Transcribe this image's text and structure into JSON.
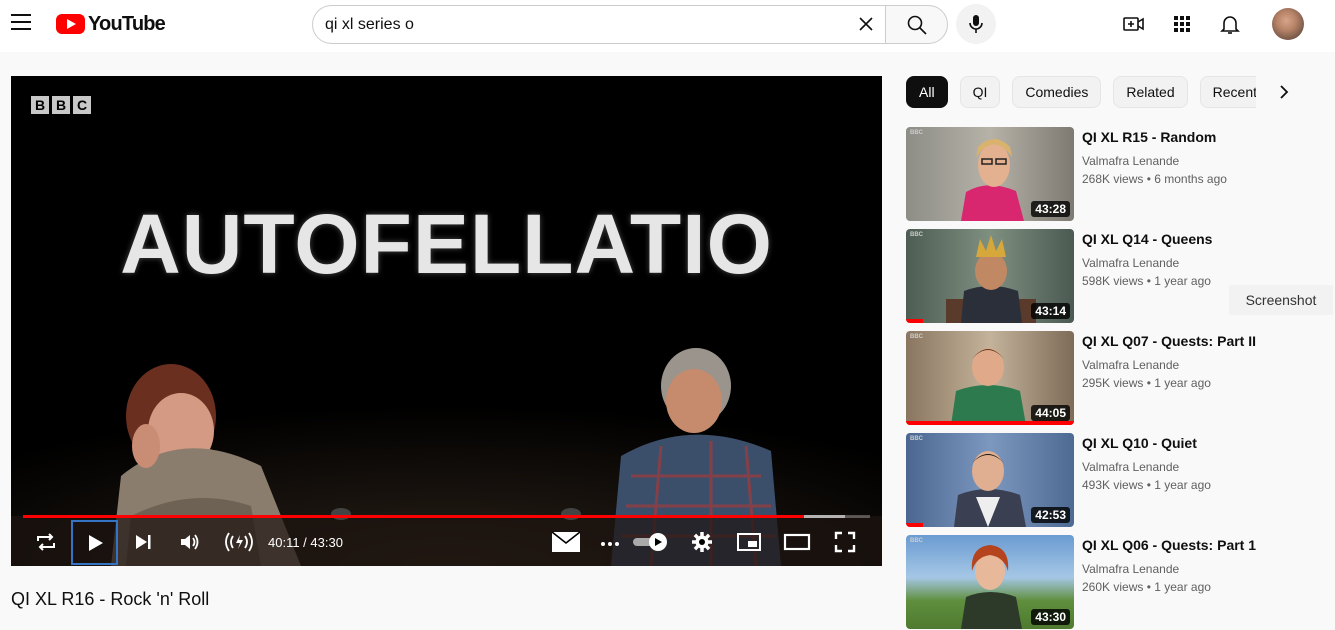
{
  "header": {
    "logo_text": "YouTube",
    "search_value": "qi xl series o",
    "icons": [
      "menu-icon",
      "youtube-logo",
      "clear-icon",
      "search-icon",
      "mic-icon",
      "create-icon",
      "apps-icon",
      "notifications-icon",
      "avatar"
    ]
  },
  "player": {
    "channel_logo": [
      "B",
      "B",
      "C"
    ],
    "caption": "AUTOFELLATIO",
    "time": "40:11 / 43:30",
    "progress_played_percent": 92.2,
    "progress_loaded_percent": 97
  },
  "video": {
    "title": "QI XL R16 - Rock 'n' Roll"
  },
  "chips": [
    "All",
    "QI",
    "Comedies",
    "Related",
    "Recently uploaded"
  ],
  "recommendations": [
    {
      "title": "QI XL R15 - Random",
      "channel": "Valmafra Lenande",
      "meta": "268K views • 6 months ago",
      "duration": "43:28",
      "watched_percent": 0
    },
    {
      "title": "QI XL Q14 - Queens",
      "channel": "Valmafra Lenande",
      "meta": "598K views • 1 year ago",
      "duration": "43:14",
      "watched_percent": 10
    },
    {
      "title": "QI XL Q07 - Quests: Part II",
      "channel": "Valmafra Lenande",
      "meta": "295K views • 1 year ago",
      "duration": "44:05",
      "watched_percent": 100
    },
    {
      "title": "QI XL Q10 - Quiet",
      "channel": "Valmafra Lenande",
      "meta": "493K views • 1 year ago",
      "duration": "42:53",
      "watched_percent": 10
    },
    {
      "title": "QI XL Q06 - Quests: Part 1",
      "channel": "Valmafra Lenande",
      "meta": "260K views • 1 year ago",
      "duration": "43:30",
      "watched_percent": 0
    }
  ],
  "tooltip": "Screenshot",
  "colors": {
    "accent": "#ff0000",
    "chip_active": "#0f0f0f"
  }
}
